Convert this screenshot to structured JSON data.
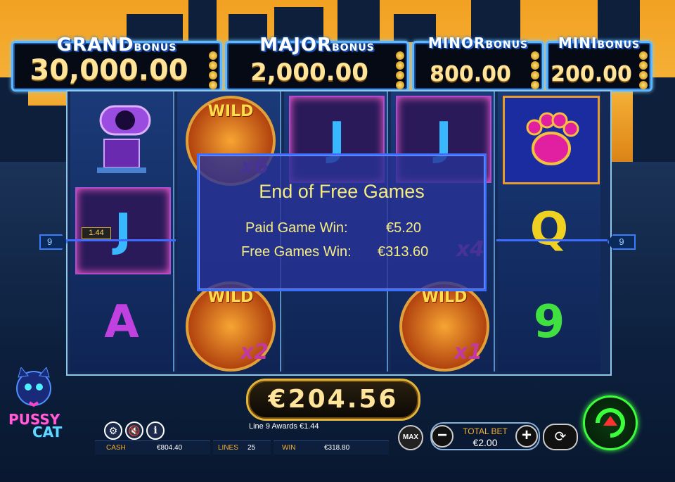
{
  "game": {
    "logo_top": "PUSSY",
    "logo_bottom": "CAT"
  },
  "jackpots": [
    {
      "title_big": "GRAND",
      "title_small": "BONUS",
      "value": "30,000.00"
    },
    {
      "title_big": "MAJOR",
      "title_small": "BONUS",
      "value": "2,000.00"
    },
    {
      "title_big": "MINOR",
      "title_small": "BONUS",
      "value": "800.00"
    },
    {
      "title_big": "MINI",
      "title_small": "BONUS",
      "value": "200.00"
    }
  ],
  "reels": {
    "r1": {
      "s1": "cannon-machine",
      "s2": "J",
      "s2_win": "1.44",
      "s3": "A"
    },
    "r2": {
      "s1_wild": "WILD",
      "s1_mult": "x6",
      "s3_wild": "WILD",
      "s3_mult": "x2"
    },
    "r3": {
      "s1": "J"
    },
    "r4": {
      "s1": "J",
      "s2_mult": "x4",
      "s3_wild": "WILD",
      "s3_mult": "x1"
    },
    "r5": {
      "s1": "paw-bonus",
      "s2": "Q",
      "s3": "9"
    }
  },
  "payline": {
    "left": "9",
    "right": "9"
  },
  "dialog": {
    "title": "End of Free Games",
    "paid_label": "Paid Game Win:",
    "paid_value": "€5.20",
    "free_label": "Free Games Win:",
    "free_value": "€313.60"
  },
  "win_display": "€204.56",
  "line_award": "Line 9 Awards €1.44",
  "status": {
    "cash_label": "CASH",
    "cash_value": "€804.40",
    "lines_label": "LINES",
    "lines_value": "25",
    "win_label": "WIN",
    "win_value": "€318.80"
  },
  "bet": {
    "max_label": "MAX",
    "total_label": "TOTAL BET",
    "total_value": "€2.00"
  },
  "icons": [
    "gear-icon",
    "sound-muted-icon",
    "info-icon",
    "minus-icon",
    "plus-icon",
    "autoplay-icon",
    "spin-icon"
  ],
  "colors": {
    "accent": "#f6ec7e",
    "jackpot_border": "#5fb8ff",
    "win_gold": "#ffe49a",
    "spin_green": "#3cff3c"
  }
}
